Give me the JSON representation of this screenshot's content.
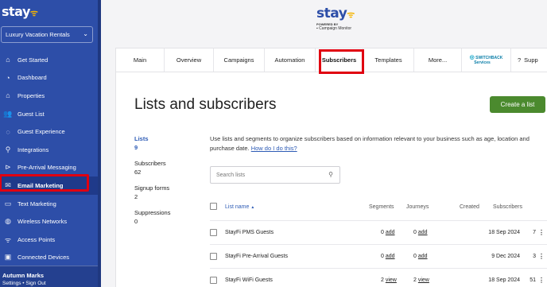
{
  "sidebar": {
    "logo": "stay",
    "org_select": "Luxury Vacation Rentals",
    "items": [
      {
        "icon": "home-icon",
        "glyph": "⌂",
        "label": "Get Started"
      },
      {
        "icon": "dashboard-icon",
        "glyph": "◔",
        "label": "Dashboard"
      },
      {
        "icon": "properties-icon",
        "glyph": "⌂",
        "label": "Properties"
      },
      {
        "icon": "guest-list-icon",
        "glyph": "👥",
        "label": "Guest List"
      },
      {
        "icon": "guest-experience-icon",
        "glyph": "◌",
        "label": "Guest Experience"
      },
      {
        "icon": "integrations-icon",
        "glyph": "⚲",
        "label": "Integrations"
      },
      {
        "icon": "pre-arrival-icon",
        "glyph": "⊳",
        "label": "Pre-Arrival Messaging"
      },
      {
        "icon": "email-icon",
        "glyph": "✉",
        "label": "Email Marketing"
      },
      {
        "icon": "text-icon",
        "glyph": "▭",
        "label": "Text Marketing"
      },
      {
        "icon": "wireless-icon",
        "glyph": "◍",
        "label": "Wireless Networks"
      },
      {
        "icon": "access-points-icon",
        "glyph": "ᯤ",
        "label": "Access Points"
      },
      {
        "icon": "devices-icon",
        "glyph": "▣",
        "label": "Connected Devices"
      }
    ],
    "user_name": "Autumn Marks",
    "user_links": "Settings • Sign Out"
  },
  "brand": {
    "name": "stay",
    "powered_by": "POWERED BY",
    "partner": "Campaign Monitor"
  },
  "tabs": [
    "Main",
    "Overview",
    "Campaigns",
    "Automation",
    "Subscribers",
    "Templates",
    "More...",
    "",
    "Supp"
  ],
  "switchback": {
    "line1": "SWITCHBACK",
    "line2": "Services"
  },
  "page": {
    "title": "Lists and subscribers",
    "create_button": "Create a list",
    "description": "Use lists and segments to organize subscribers based on information relevant to your business such as age, location and purchase date.",
    "help_link": "How do I do this?",
    "search_placeholder": "Search lists"
  },
  "left_nav": [
    {
      "label": "Lists",
      "count": "9"
    },
    {
      "label": "Subscribers",
      "count": "62"
    },
    {
      "label": "Signup forms",
      "count": "2"
    },
    {
      "label": "Suppressions",
      "count": "0"
    }
  ],
  "table": {
    "headers": {
      "name": "List name",
      "sort": "▲",
      "segments": "Segments",
      "journeys": "Journeys",
      "created": "Created",
      "subscribers": "Subscribers"
    },
    "rows": [
      {
        "name": "StayFi PMS Guests",
        "seg_n": "0",
        "seg_link": "add",
        "jrn_n": "0",
        "jrn_link": "add",
        "created": "18 Sep 2024",
        "subscribers": "7"
      },
      {
        "name": "StayFi Pre-Arrival Guests",
        "seg_n": "0",
        "seg_link": "add",
        "jrn_n": "0",
        "jrn_link": "add",
        "created": "9 Dec 2024",
        "subscribers": "3"
      },
      {
        "name": "StayFi WiFi Guests",
        "seg_n": "2",
        "seg_link": "view",
        "jrn_n": "2",
        "jrn_link": "view",
        "created": "18 Sep 2024",
        "subscribers": "51"
      }
    ]
  },
  "colors": {
    "sidebar": "#2d4ea8",
    "accent_green": "#4b8a2e",
    "highlight_red": "#e00010",
    "link_blue": "#2d5bb5"
  }
}
